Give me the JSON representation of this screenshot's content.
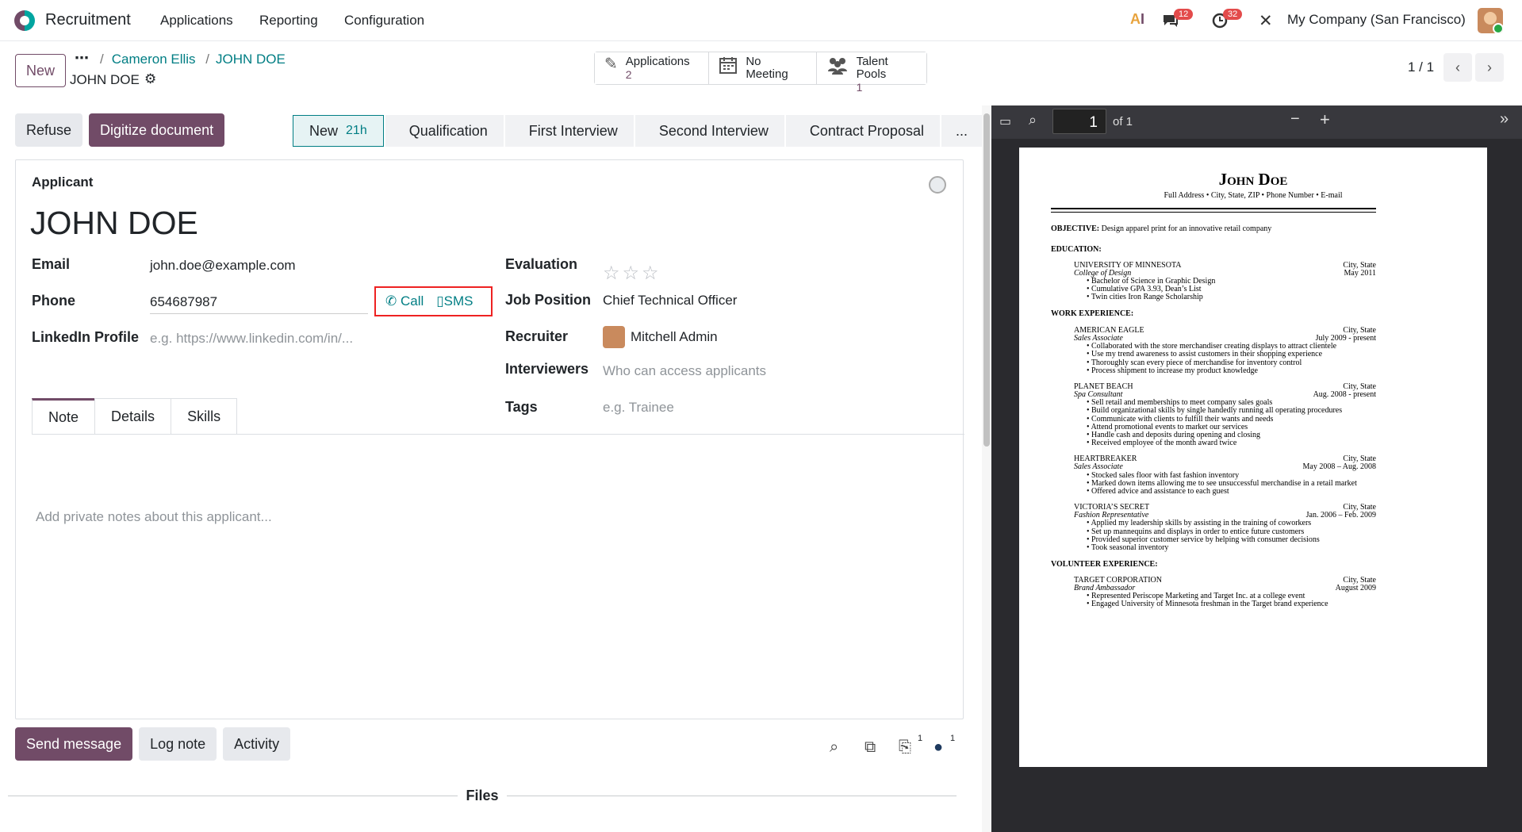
{
  "nav": {
    "app": "Recruitment",
    "menus": [
      "Applications",
      "Reporting",
      "Configuration"
    ],
    "messages_count": "12",
    "activities_count": "32",
    "company": "My Company (San Francisco)"
  },
  "control": {
    "new_label": "New",
    "breadcrumb_parent": "Cameron Ellis",
    "breadcrumb_current": "JOHN DOE",
    "record_name": "JOHN DOE",
    "pager": "1 / 1"
  },
  "smart_buttons": [
    {
      "label": "Applications",
      "count": "2"
    },
    {
      "label": "No Meeting",
      "count": ""
    },
    {
      "label": "Talent Pools",
      "count": "1"
    }
  ],
  "status": {
    "refuse": "Refuse",
    "digitize": "Digitize document",
    "stages": [
      "New",
      "Qualification",
      "First Interview",
      "Second Interview",
      "Contract Proposal",
      "..."
    ],
    "current_duration": "21h"
  },
  "form": {
    "applicant_label": "Applicant",
    "name": "JOHN DOE",
    "email_label": "Email",
    "email": "john.doe@example.com",
    "phone_label": "Phone",
    "phone": "654687987",
    "call": "Call",
    "sms": "SMS",
    "linkedin_label": "LinkedIn Profile",
    "linkedin_placeholder": "e.g. https://www.linkedin.com/in/...",
    "evaluation_label": "Evaluation",
    "evaluation_stars": 0,
    "job_label": "Job Position",
    "job": "Chief Technical Officer",
    "recruiter_label": "Recruiter",
    "recruiter": "Mitchell Admin",
    "interviewers_label": "Interviewers",
    "interviewers_placeholder": "Who can access applicants",
    "tags_label": "Tags",
    "tags_placeholder": "e.g. Trainee"
  },
  "tabs": [
    "Note",
    "Details",
    "Skills"
  ],
  "note_placeholder": "Add private notes about this applicant...",
  "chatter": {
    "send": "Send message",
    "log": "Log note",
    "activity": "Activity",
    "attachments_count": "1",
    "followers_count": "1",
    "files_label": "Files"
  },
  "pdf": {
    "page": "1",
    "of": "of 1",
    "resume": {
      "name": "John Doe",
      "contact": "Full Address • City, State, ZIP • Phone Number • E-mail",
      "objective_label": "OBJECTIVE:",
      "objective": "Design apparel print for an innovative retail company",
      "education_label": "EDUCATION:",
      "edu_school": "UNIVERSITY OF MINNESOTA",
      "edu_college": "College of Design",
      "edu_loc": "City, State",
      "edu_date": "May 2011",
      "edu_bullets": [
        "Bachelor of Science in Graphic Design",
        "Cumulative GPA 3.93, Dean’s List",
        "Twin cities Iron Range Scholarship"
      ],
      "work_label": "WORK EXPERIENCE:",
      "jobs": [
        {
          "company": "AMERICAN EAGLE",
          "role": "Sales Associate",
          "loc": "City, State",
          "date": "July 2009 - present",
          "bullets": [
            "Collaborated with the store merchandiser creating displays to attract clientele",
            "Use my trend awareness to assist customers in their shopping experience",
            "Thoroughly scan every piece of merchandise for inventory control",
            "Process shipment to increase my product knowledge"
          ]
        },
        {
          "company": "PLANET BEACH",
          "role": "Spa Consultant",
          "loc": "City, State",
          "date": "Aug. 2008 - present",
          "bullets": [
            "Sell retail and memberships to meet company sales goals",
            "Build organizational skills by single handedly running all operating procedures",
            "Communicate with clients to fulfill their wants and needs",
            "Attend promotional events to market our services",
            "Handle cash and deposits during opening and closing",
            "Received employee of the month award twice"
          ]
        },
        {
          "company": "HEARTBREAKER",
          "role": "Sales Associate",
          "loc": "City, State",
          "date": "May 2008 – Aug. 2008",
          "bullets": [
            "Stocked sales floor with fast fashion inventory",
            "Marked down items allowing me to see unsuccessful merchandise in a retail market",
            "Offered advice and assistance to each guest"
          ]
        },
        {
          "company": "VICTORIA’S SECRET",
          "role": "Fashion Representative",
          "loc": "City, State",
          "date": "Jan. 2006 – Feb. 2009",
          "bullets": [
            "Applied my leadership skills by assisting in the training of coworkers",
            "Set up mannequins and displays in order to entice future customers",
            "Provided superior customer service by helping with consumer decisions",
            "Took seasonal inventory"
          ]
        }
      ],
      "volunteer_label": "VOLUNTEER EXPERIENCE:",
      "vol": {
        "company": "TARGET CORPORATION",
        "role": "Brand Ambassador",
        "loc": "City, State",
        "date": "August 2009",
        "bullets": [
          "Represented Periscope Marketing and Target Inc. at a college event",
          "Engaged University of Minnesota freshman in the Target brand experience"
        ]
      }
    }
  }
}
